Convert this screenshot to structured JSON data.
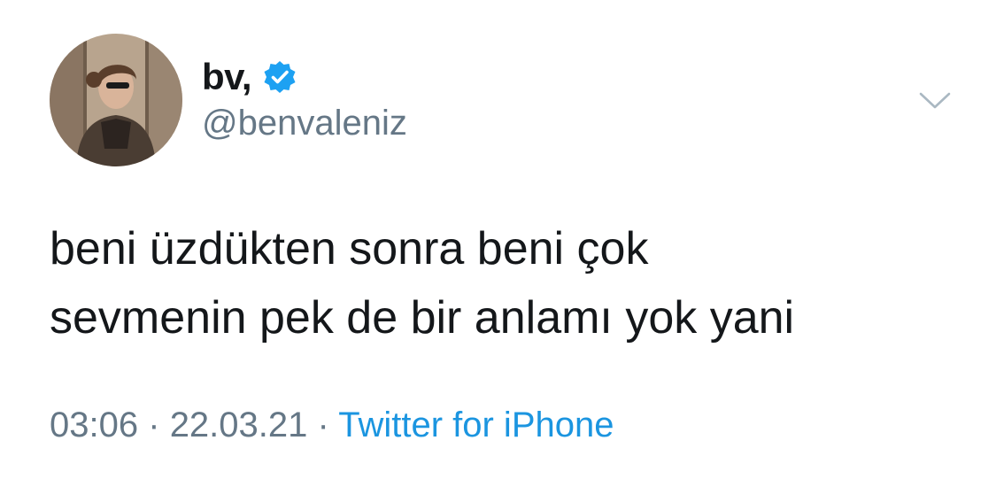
{
  "user": {
    "display_name": "bv,",
    "handle": "@benvaleniz",
    "verified_icon": "verified-badge-icon",
    "avatar_icon": "profile-photo"
  },
  "tweet": {
    "lines": [
      "beni üzdükten sonra beni çok",
      "sevmenin pek de bir anlamı yok yani"
    ],
    "time": "03:06",
    "separator": "·",
    "date": "22.03.21",
    "source": "Twitter for iPhone"
  },
  "menu_icon": "chevron-down-icon",
  "colors": {
    "text": "#14171a",
    "secondary": "#657786",
    "accent": "#1b95e0",
    "verified": "#1da1f2"
  }
}
